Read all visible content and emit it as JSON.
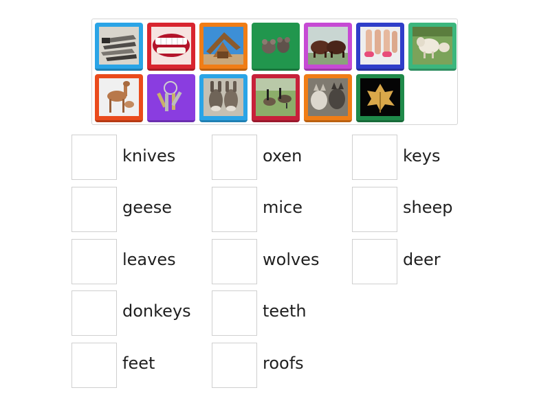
{
  "colors": {
    "tile_blue": "#2aa4e6",
    "tile_red": "#d8252f",
    "tile_orange": "#f07d16",
    "tile_green": "#21964d",
    "tile_purple": "#c64ad4",
    "tile_navy": "#2f3ec9",
    "tile_mint": "#3cb67d",
    "tile_orange_red": "#ea4b1c",
    "tile_violet": "#8a3de0",
    "tile_crimson": "#c7213a",
    "tile_dark_green": "#1f8a4a"
  },
  "tiles": [
    {
      "picture": "knives",
      "color": "#2aa4e6"
    },
    {
      "picture": "teeth",
      "color": "#d8252f"
    },
    {
      "picture": "roofs",
      "color": "#f07d16"
    },
    {
      "picture": "mice",
      "color": "#21964d"
    },
    {
      "picture": "oxen",
      "color": "#c64ad4"
    },
    {
      "picture": "feet",
      "color": "#2f3ec9"
    },
    {
      "picture": "sheep",
      "color": "#3cb67d"
    },
    {
      "picture": "deer",
      "color": "#ea4b1c"
    },
    {
      "picture": "keys",
      "color": "#8a3de0"
    },
    {
      "picture": "donkeys",
      "color": "#2aa4e6"
    },
    {
      "picture": "geese",
      "color": "#c7213a"
    },
    {
      "picture": "wolves",
      "color": "#f07d16"
    },
    {
      "picture": "leaves",
      "color": "#1f8a4a"
    }
  ],
  "words": {
    "col1": [
      "knives",
      "geese",
      "leaves",
      "donkeys",
      "feet"
    ],
    "col2": [
      "oxen",
      "mice",
      "wolves",
      "teeth",
      "roofs"
    ],
    "col3": [
      "keys",
      "sheep",
      "deer"
    ]
  }
}
